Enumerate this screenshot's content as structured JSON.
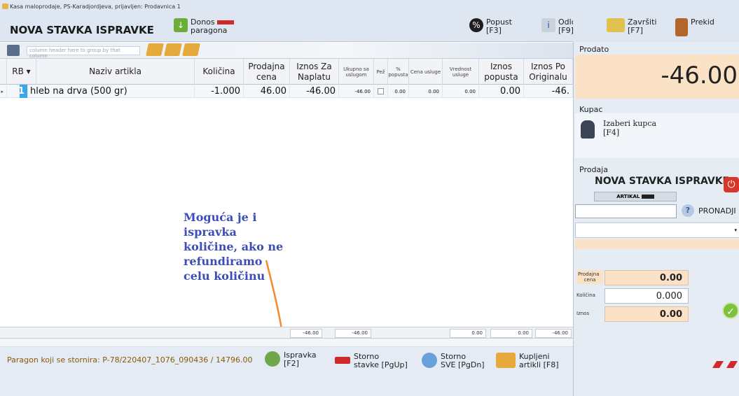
{
  "window": {
    "title": "Kasa maloprodaje, PS-Karadjordjeva, prijavljen: Prodavnica 1"
  },
  "header": {
    "title": "NOVA STAVKA ISPRAVKE",
    "donos_line1": "Donos",
    "donos_line2": "paragona",
    "popust_line1": "Popust",
    "popust_line2": "[F3]",
    "odlozi_line1": "Odloži",
    "odlozi_line2": "[F9]",
    "zavrsiti_line1": "Završiti",
    "zavrsiti_line2": "[F7]",
    "prekid": "Prekid"
  },
  "grid": {
    "group_hint": "column header here to group by that column",
    "columns": [
      "RB",
      "Naziv artikla",
      "Količina",
      "Prodajna cena",
      "Iznos Za Naplatu",
      "Ukupno sa uslugom",
      "Pež",
      "% popusta",
      "Cena usluge",
      "Vrednost usluge",
      "Iznos popusta",
      "Iznos Po Originalu"
    ],
    "rows": [
      {
        "rb": "1",
        "naziv": "hleb na drva (500 gr)",
        "kolicina": "-1.000",
        "prodajna_cena": "46.00",
        "iznos_za_naplatu": "-46.00",
        "ukupno_sa_uslugom": "-46.00",
        "procenat_popusta": "0.00",
        "cena_usluge": "0.00",
        "vrednost_usluge": "0.00",
        "iznos_popusta": "0.00",
        "iznos_po_originalu": "-46."
      }
    ],
    "totals": {
      "iznos_za_naplatu": "-46.00",
      "ukupno_sa_uslugom": "-46.00",
      "vrednost_usluge": "0.00",
      "iznos_popusta": "0.00",
      "iznos_po_originalu": "-46.00"
    }
  },
  "annotation": {
    "lines": [
      "Moguća je i",
      "ispravka",
      "količine, ako ne",
      "refundiramo",
      "celu količinu"
    ]
  },
  "bottom": {
    "storno_info": "Paragon koji se stornira: P-78/220407_1076_090436 / 14796.00",
    "ispravka_line1": "Ispravka",
    "ispravka_line2": "[F2]",
    "storno_stavke_line1": "Storno",
    "storno_stavke_line2": "stavke [PgUp]",
    "storno_sve_line1": "Storno",
    "storno_sve_line2": "SVE [PgDn]",
    "kupljeni_line1": "Kupljeni",
    "kupljeni_line2": "artikli [F8]"
  },
  "right_panel": {
    "prodato_label": "Prodato",
    "prodato_value": "-46.00",
    "kupac_label": "Kupac",
    "izaberi_line1": "Izaberi kupca",
    "izaberi_line2": "[F4]",
    "prodaja_label": "Prodaja",
    "prodaja_title": "NOVA STAVKA ISPRAVKE",
    "artikal_label": "ARTIKAL",
    "pronadji": "PRONADJI",
    "prodajna_cena_line1": "Prodajna",
    "prodajna_cena_line2": "cena",
    "prodajna_cena_value": "0.00",
    "kolicina_label": "Količina",
    "kolicina_value": "0.000",
    "iznos_label": "Iznos",
    "iznos_value": "0.00"
  },
  "colors": {
    "accent_orange": "#f28a2e",
    "selected_blue": "#3aa8e8",
    "annotation_blue": "#3d4db7",
    "peach": "#fbe1c6"
  },
  "icons": [
    "download-icon",
    "percent-icon",
    "info-icon",
    "cash-icon",
    "exit-door-icon",
    "printer-icon",
    "refresh-icon",
    "remove-icon",
    "box-icon",
    "person-icon",
    "help-icon",
    "power-icon",
    "ok-icon"
  ]
}
